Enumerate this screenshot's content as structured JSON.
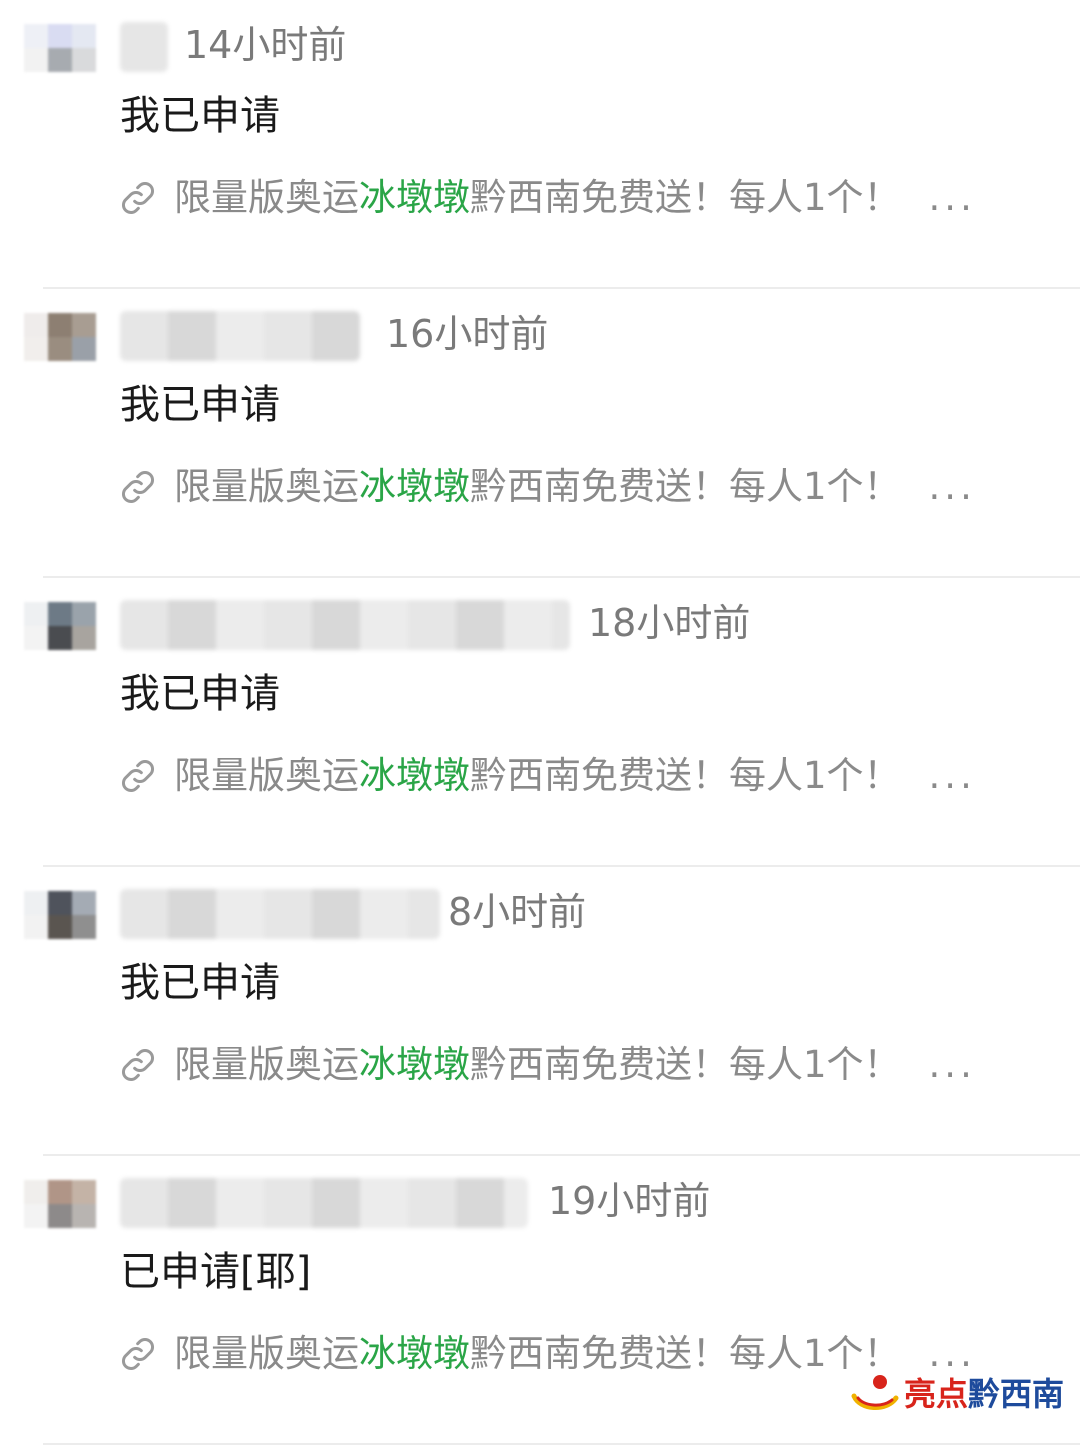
{
  "comments": [
    {
      "time": "14小时前",
      "text": "我已申请",
      "link": {
        "before": "限量版奥运",
        "highlight": "冰墩墩",
        "after": "黔西南免费送！每人1个！",
        "ellipsis": "..."
      }
    },
    {
      "time": "16小时前",
      "text": "我已申请",
      "link": {
        "before": "限量版奥运",
        "highlight": "冰墩墩",
        "after": "黔西南免费送！每人1个！",
        "ellipsis": "..."
      }
    },
    {
      "time": "18小时前",
      "text": "我已申请",
      "link": {
        "before": "限量版奥运",
        "highlight": "冰墩墩",
        "after": "黔西南免费送！每人1个！",
        "ellipsis": "..."
      }
    },
    {
      "time": "8小时前",
      "text": "我已申请",
      "link": {
        "before": "限量版奥运",
        "highlight": "冰墩墩",
        "after": "黔西南免费送！每人1个！",
        "ellipsis": "..."
      }
    },
    {
      "time": "19小时前",
      "text": "已申请[耶]",
      "link": {
        "before": "限量版奥运",
        "highlight": "冰墩墩",
        "after": "黔西南免费送！每人1个！",
        "ellipsis": "..."
      }
    }
  ],
  "watermark": {
    "part1": "亮点",
    "part2": "黔西南"
  },
  "colors": {
    "highlight": "#2aa547",
    "time": "#7a7a7a",
    "link": "#8a8a8a",
    "watermark_red": "#d8241b",
    "watermark_blue": "#1e4b9c"
  },
  "icons": {
    "link": "link-icon",
    "avatar": "avatar-pixelated",
    "name": "name-pixelated"
  }
}
